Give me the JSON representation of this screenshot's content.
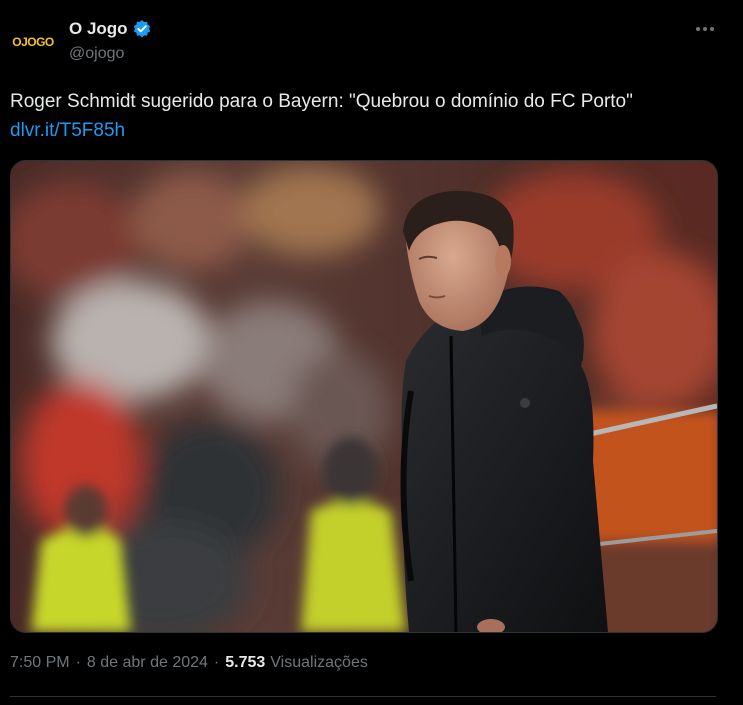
{
  "account": {
    "display_name": "O Jogo",
    "handle": "@ojogo",
    "logo_text": "OJOGO",
    "verified": true
  },
  "tweet": {
    "text": "Roger Schmidt sugerido para o Bayern: \"Quebrou o domínio do FC Porto\"",
    "link": "dlvr.it/T5F85h"
  },
  "media": {
    "description": "coach-photo"
  },
  "meta": {
    "time": "7:50 PM",
    "separator": "·",
    "date": "8 de abr de 2024",
    "views_count": "5.753",
    "views_label": "Visualizações"
  },
  "icons": {
    "verified": "verified-badge-icon",
    "more": "more-dots-icon"
  },
  "colors": {
    "background": "#000000",
    "text": "#e7e9ea",
    "secondary": "#71767b",
    "link": "#1d9bf0",
    "logo": "#f2c230",
    "border": "#2f3336"
  }
}
